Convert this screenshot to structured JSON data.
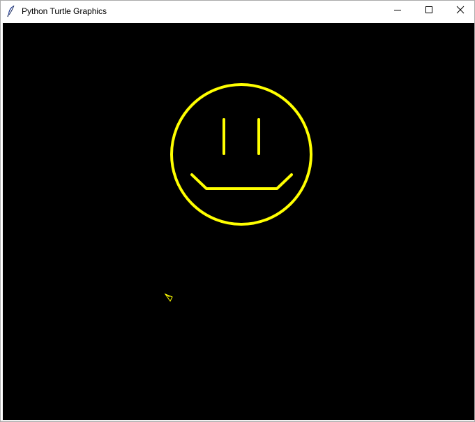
{
  "window": {
    "title": "Python Turtle Graphics",
    "app_icon": "feather-icon"
  },
  "controls": {
    "minimize_icon": "minimize-icon",
    "maximize_icon": "maximize-icon",
    "close_icon": "close-icon"
  },
  "canvas": {
    "background_color": "#000000",
    "pen_color": "#ffff00",
    "drawing": "smiley-face",
    "turtle_icon": "turtle-arrow-icon"
  }
}
